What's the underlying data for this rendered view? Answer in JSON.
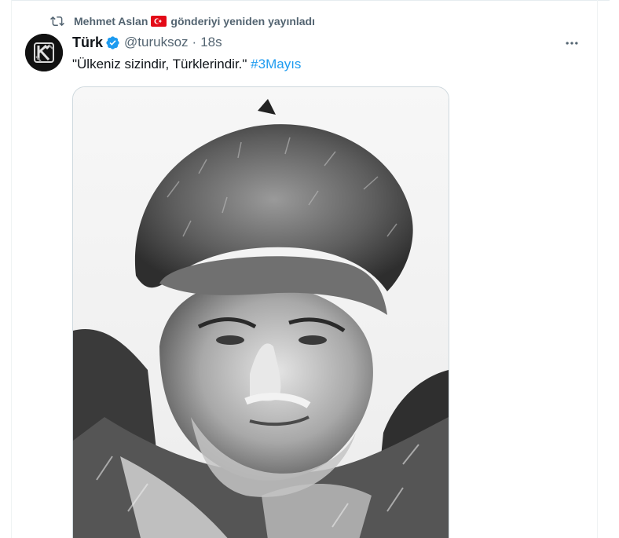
{
  "retweet": {
    "retweeter_name": "Mehmet Aslan",
    "action_text": "gönderiyi yeniden yayınladı",
    "icon": "retweet-icon",
    "flag_icon": "turkey-flag-icon"
  },
  "tweet": {
    "author": {
      "display_name": "Türk",
      "handle": "@turuksoz",
      "verified": true,
      "avatar_icon": "emblem-logo"
    },
    "separator": "·",
    "timestamp": "18s",
    "text": "\"Ülkeniz sizindir, Türklerindir.\"",
    "hashtag": "#3Mayıs",
    "media": {
      "type": "photo",
      "description_icon": "portrait-photo"
    }
  },
  "colors": {
    "accent": "#1d9bf0",
    "text_primary": "#0f1419",
    "text_secondary": "#536471",
    "border": "#cfd9de",
    "flag_red": "#e30a17"
  },
  "menu": {
    "more_icon": "more-horizontal-icon"
  }
}
